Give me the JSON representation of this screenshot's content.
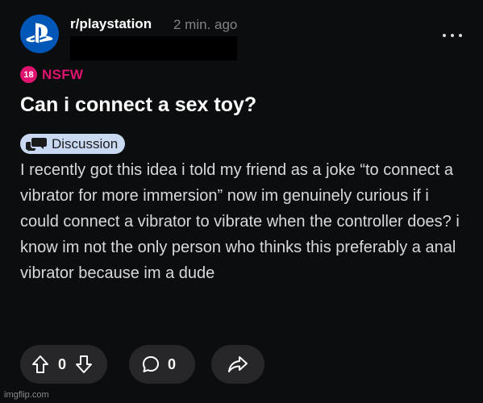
{
  "header": {
    "subreddit": "r/playstation",
    "time_ago": "2 min. ago",
    "avatar_icon": "playstation-logo-icon",
    "more_icon": "more-options-icon"
  },
  "post": {
    "nsfw_badge": "18",
    "nsfw_label": "NSFW",
    "title": "Can i connect a sex toy?",
    "flair": {
      "label": "Discussion",
      "icon": "discussion-icon",
      "color": "#c9d9f2"
    },
    "body": "I recently got this idea i told my friend as a joke “to connect a vibrator for more immersion” now im genuinely curious if i could connect a vibrator to vibrate when the controller does? i know im not the only person who thinks this preferably a anal vibrator because im a dude"
  },
  "actions": {
    "vote_count": "0",
    "comment_count": "0",
    "upvote_icon": "upvote-icon",
    "downvote_icon": "downvote-icon",
    "comment_icon": "comment-icon",
    "share_icon": "share-icon"
  },
  "watermark": "imgflip.com",
  "colors": {
    "background": "#0b0d0e",
    "nsfw": "#e0146e",
    "brand_playstation": "#0057b8",
    "pill_background": "#272729"
  }
}
